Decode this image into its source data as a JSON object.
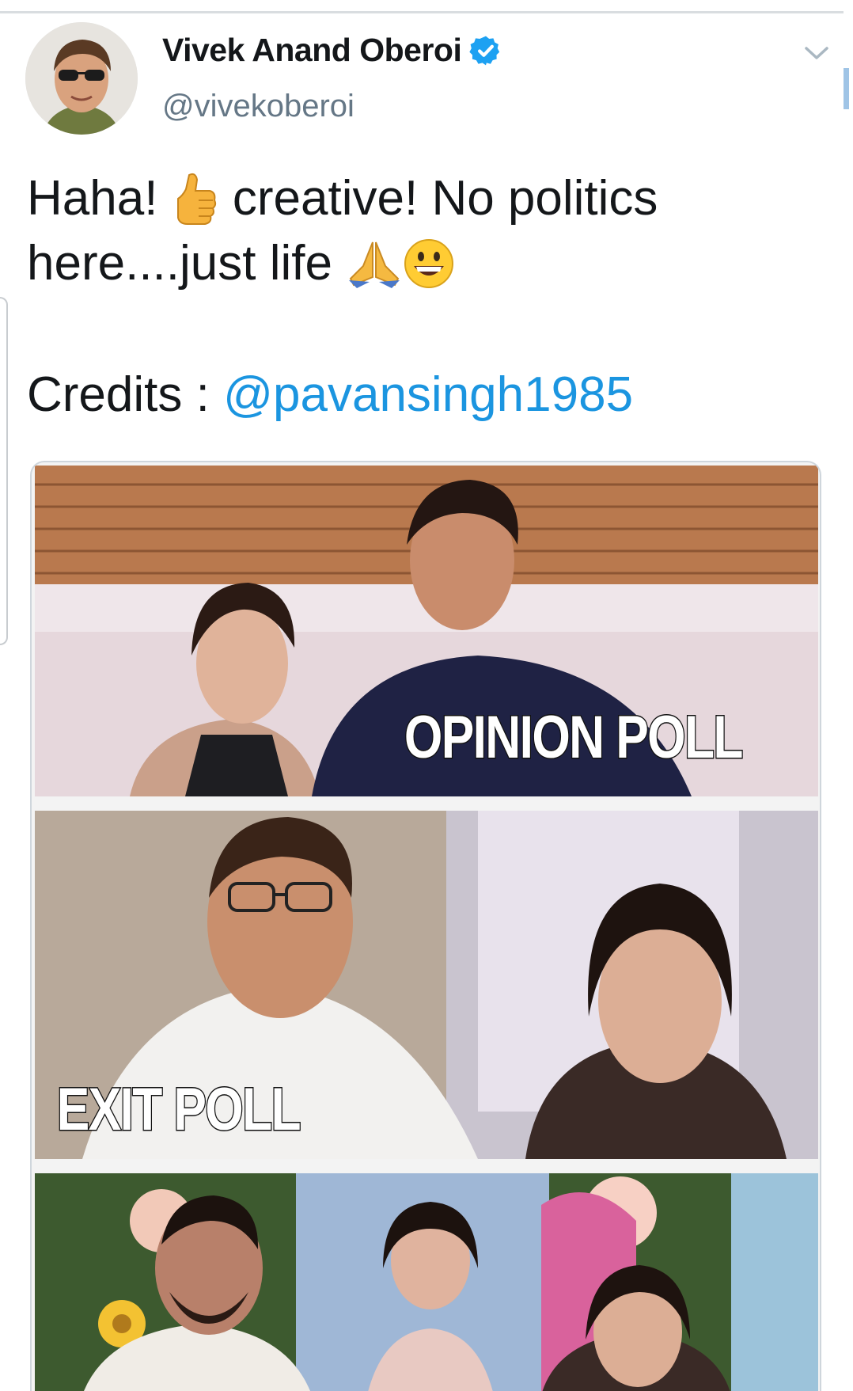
{
  "tweet": {
    "author_name": "Vivek Anand Oberoi",
    "handle": "@vivekoberoi",
    "text_line1_a": "Haha! ",
    "text_line1_b": " creative! No politics",
    "text_line2": "here....just life ",
    "credits_label": "Credits : ",
    "credits_mention": "@pavansingh1985",
    "emoji": [
      "thumbs-up",
      "folded-hands",
      "grinning-face"
    ]
  },
  "meme": {
    "panels": [
      {
        "caption": "OPINION POLL"
      },
      {
        "caption": "EXIT POLL"
      },
      {
        "caption": ""
      }
    ]
  },
  "colors": {
    "link": "#1b95e0",
    "verified": "#1da1f2",
    "handle": "#657786"
  }
}
